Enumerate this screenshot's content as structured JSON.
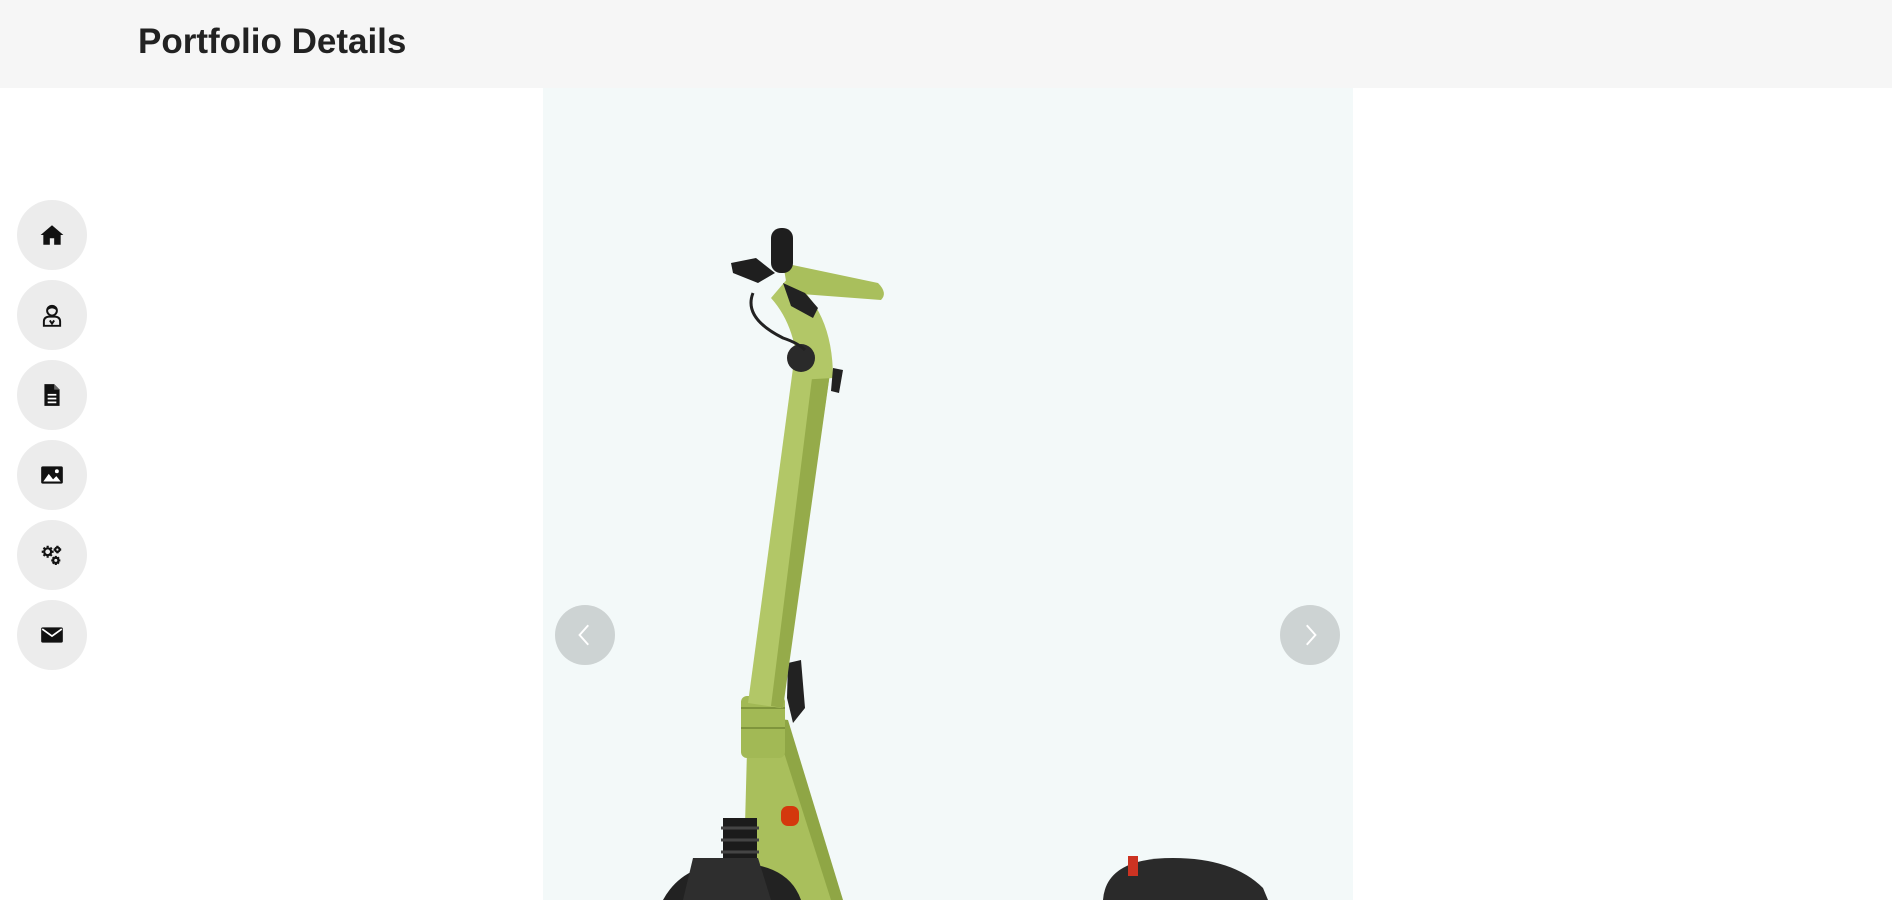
{
  "header": {
    "title": "Portfolio Details"
  },
  "nav": {
    "items": [
      {
        "name": "home",
        "icon": "home-icon"
      },
      {
        "name": "about",
        "icon": "user-icon"
      },
      {
        "name": "resume",
        "icon": "document-icon"
      },
      {
        "name": "portfolio",
        "icon": "image-icon"
      },
      {
        "name": "services",
        "icon": "gears-icon"
      },
      {
        "name": "contact",
        "icon": "envelope-icon"
      }
    ]
  },
  "slider": {
    "image": {
      "subject": "green electric scooter",
      "icon": "scooter-image"
    },
    "prev_icon": "chevron-left-icon",
    "next_icon": "chevron-right-icon"
  },
  "colors": {
    "header_bg": "#f6f6f6",
    "nav_bg": "#ececec",
    "slide_bg": "#f3f9f9",
    "scooter": "#a9bf5c"
  }
}
